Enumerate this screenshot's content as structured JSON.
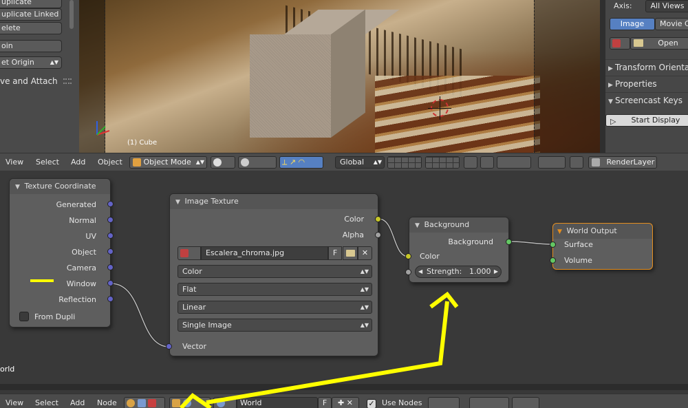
{
  "tool_panel": {
    "buttons": [
      "uplicate",
      "uplicate Linked",
      "elete",
      "oin",
      "et Origin"
    ],
    "label": "ve and Attach"
  },
  "viewport": {
    "object_label": "(1) Cube"
  },
  "right_panel": {
    "axis_label": "Axis:",
    "axis_value": "All Views",
    "tab_image": "Image",
    "tab_movie": "Movie C",
    "open_button": "Open",
    "sections": [
      "Transform Orientat",
      "Properties",
      "Screencast Keys"
    ],
    "start_display": "Start Display"
  },
  "view3d_header": {
    "menus": [
      "View",
      "Select",
      "Add",
      "Object"
    ],
    "mode": "Object Mode",
    "orientation": "Global",
    "render_layer": "RenderLayer"
  },
  "node_editor": {
    "area_label": "orld",
    "texture_coordinate": {
      "title": "Texture Coordinate",
      "outputs": [
        "Generated",
        "Normal",
        "UV",
        "Object",
        "Camera",
        "Window",
        "Reflection"
      ],
      "from_dupli": "From Dupli"
    },
    "image_texture": {
      "title": "Image Texture",
      "outputs": [
        "Color",
        "Alpha"
      ],
      "image_name": "Escalera_chroma.jpg",
      "fake_user": "F",
      "color_space": "Color",
      "projection": "Flat",
      "interpolation": "Linear",
      "extension": "Single Image",
      "input": "Vector"
    },
    "background": {
      "title": "Background",
      "output": "Background",
      "input_color": "Color",
      "strength_label": "Strength:",
      "strength_value": "1.000"
    },
    "world_output": {
      "title": "World Output",
      "inputs": [
        "Surface",
        "Volume"
      ]
    }
  },
  "node_header": {
    "menus": [
      "View",
      "Select",
      "Add",
      "Node"
    ],
    "world_name": "World",
    "fake_user": "F",
    "use_nodes": "Use Nodes"
  },
  "colors": {
    "annotation": "#ffff00",
    "active_tab": "#5680c2",
    "world_output_border": "#e58e1e"
  }
}
